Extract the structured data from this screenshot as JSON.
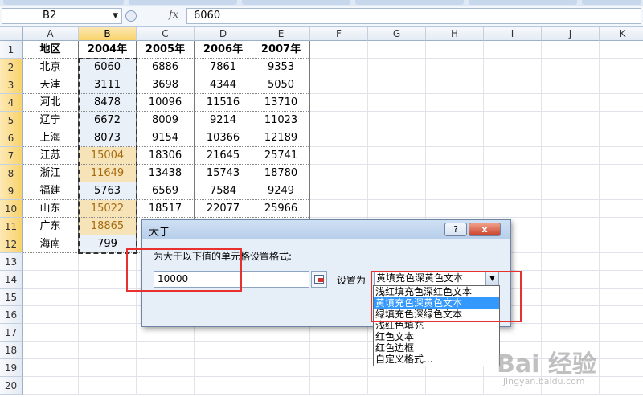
{
  "formula_bar": {
    "name_box": "B2",
    "fx_label": "fx",
    "formula": "6060"
  },
  "columns": [
    "A",
    "B",
    "C",
    "D",
    "E",
    "F",
    "G",
    "H",
    "I",
    "J",
    "K"
  ],
  "rows": [
    "1",
    "2",
    "3",
    "4",
    "5",
    "6",
    "7",
    "8",
    "9",
    "10",
    "11",
    "12",
    "13",
    "14",
    "15",
    "16",
    "17",
    "18",
    "19",
    "20"
  ],
  "table": {
    "header": [
      "地区",
      "2004年",
      "2005年",
      "2006年",
      "2007年"
    ],
    "body": [
      [
        "北京",
        "6060",
        "6886",
        "7861",
        "9353"
      ],
      [
        "天津",
        "3111",
        "3698",
        "4344",
        "5050"
      ],
      [
        "河北",
        "8478",
        "10096",
        "11516",
        "13710"
      ],
      [
        "辽宁",
        "6672",
        "8009",
        "9214",
        "11023"
      ],
      [
        "上海",
        "8073",
        "9154",
        "10366",
        "12189"
      ],
      [
        "江苏",
        "15004",
        "18306",
        "21645",
        "25741"
      ],
      [
        "浙江",
        "11649",
        "13438",
        "15743",
        "18780"
      ],
      [
        "福建",
        "5763",
        "6569",
        "7584",
        "9249"
      ],
      [
        "山东",
        "15022",
        "18517",
        "22077",
        "25966"
      ],
      [
        "广东",
        "18865",
        "",
        "",
        ""
      ],
      [
        "海南",
        "799",
        "",
        "",
        ""
      ]
    ],
    "highlighted_rows": [
      5,
      6,
      8,
      9
    ],
    "colors": {
      "highlight_bg": "#f6e4b8",
      "highlight_text": "#a66b10"
    }
  },
  "dialog": {
    "title": "大于",
    "help_button": "?",
    "close_button": "x",
    "instruction": "为大于以下值的单元格设置格式:",
    "value": "10000",
    "set_label": "设置为",
    "format_selected": "黄填充色深黄色文本",
    "format_options": [
      "浅红填充色深红色文本",
      "黄填充色深黄色文本",
      "绿填充色深绿色文本",
      "浅红色填充",
      "红色文本",
      "红色边框",
      "自定义格式..."
    ],
    "active_option_index": 1
  },
  "watermark": {
    "line1": "Bai 经验",
    "line2": "jingyan.baidu.com"
  },
  "annotation_color": "#e8302e"
}
